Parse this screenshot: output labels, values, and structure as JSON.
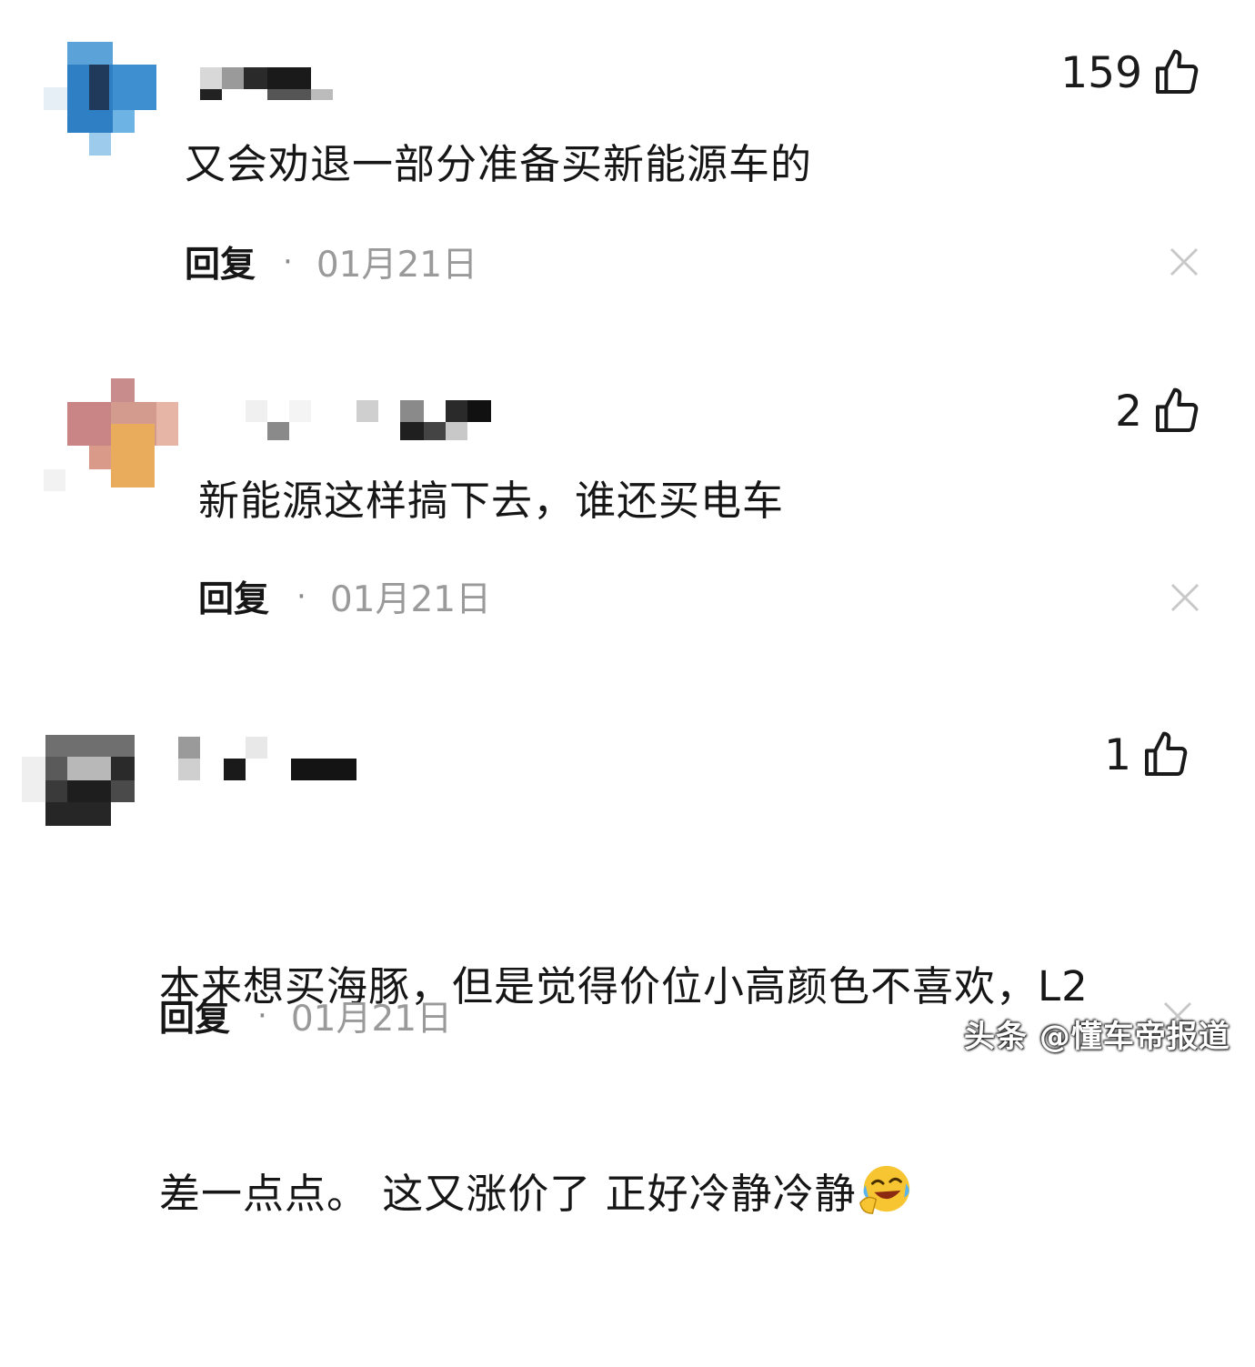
{
  "comments": [
    {
      "text": "又会劝退一部分准备买新能源车的",
      "likes": "159",
      "reply_label": "回复",
      "separator": "·",
      "date": "01月21日"
    },
    {
      "text": "新能源这样搞下去，谁还买电车",
      "likes": "2",
      "reply_label": "回复",
      "separator": "·",
      "date": "01月21日"
    },
    {
      "text_line1": "本来想买海豚，但是觉得价位小高颜色不喜欢，L2",
      "text_line2": "差一点点。 这又涨价了 正好冷静冷静",
      "likes": "1",
      "reply_label": "回复",
      "separator": "·",
      "date": "01月21日"
    }
  ],
  "watermark": "头条 @懂车帝报道",
  "icons": {
    "like": "thumbs-up-icon",
    "close": "close-icon",
    "emoji": "laughing-crying-emoji-icon"
  },
  "colors": {
    "text": "#161616",
    "meta": "#9a9a9a",
    "close": "#c8c8c8"
  }
}
